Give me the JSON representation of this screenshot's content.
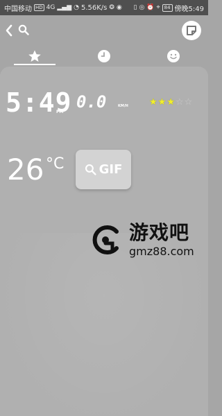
{
  "status_bar": {
    "carrier": "中国移动",
    "hd_badge": "HD",
    "network": "4G",
    "speed": "5.56K/s",
    "battery_level": "84",
    "time_label": "傍晚5:49"
  },
  "app_bar": {
    "back_icon": "chevron-left-icon",
    "search_icon": "search-icon",
    "sticker_icon": "sticker-icon"
  },
  "tabs": [
    {
      "icon": "star-icon",
      "selected": true
    },
    {
      "icon": "clock-icon",
      "selected": false
    },
    {
      "icon": "smiley-icon",
      "selected": false
    }
  ],
  "widget": {
    "time": "5:49",
    "ampm": "PM",
    "speed": "0.0",
    "speed_unit": "KM/H",
    "rating": 3,
    "rating_max": 5,
    "temperature": "26",
    "temperature_unit": "°C",
    "gif_label": "GIF"
  },
  "watermark": {
    "name": "游戏吧",
    "url": "gmz88.com"
  },
  "colors": {
    "background": "#a6a6a6",
    "card": "#b0b0b0",
    "star_on": "#f2ef2b",
    "status_bar": "#4f4f4f"
  }
}
